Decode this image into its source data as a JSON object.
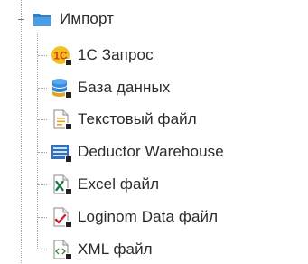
{
  "tree": {
    "root": {
      "label": "Импорт",
      "icon": "folder-open-icon",
      "expanded": true
    },
    "items": [
      {
        "label": "1С Запрос",
        "icon": "1c-logo-icon"
      },
      {
        "label": "База данных",
        "icon": "database-icon"
      },
      {
        "label": "Текстовый файл",
        "icon": "text-file-icon"
      },
      {
        "label": "Deductor Warehouse",
        "icon": "warehouse-icon"
      },
      {
        "label": "Excel файл",
        "icon": "excel-file-icon"
      },
      {
        "label": "Loginom Data файл",
        "icon": "loginom-data-file-icon"
      },
      {
        "label": "XML файл",
        "icon": "xml-file-icon"
      }
    ]
  },
  "colors": {
    "folder": "#3c8fd6",
    "database": "#3a8ee0",
    "onec_yellow": "#f2c21b",
    "onec_red": "#d43a1f",
    "excel_green": "#1e7b45",
    "loginom_red": "#c8242e",
    "guide_line": "#a8a8a8"
  }
}
